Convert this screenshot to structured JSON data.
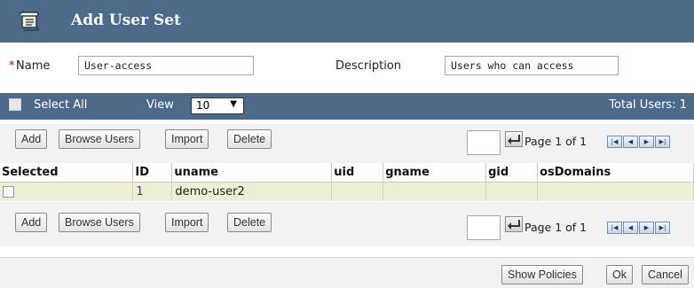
{
  "dialog": {
    "title": "Add User Set",
    "icon": "scroll-icon"
  },
  "form": {
    "required_marker": "*",
    "name_label": "Name",
    "name_value": "User-access",
    "description_label": "Description",
    "description_value": "Users who can access"
  },
  "toolbar": {
    "select_all_label": "Select All",
    "view_label": "View",
    "view_value": "10",
    "total_users": "Total Users: 1"
  },
  "actions": {
    "add": "Add",
    "browse_users": "Browse Users",
    "import": "Import",
    "delete": "Delete"
  },
  "pagination": {
    "page_text": "Page 1 of 1",
    "page_input": ""
  },
  "table": {
    "headers": [
      "Selected",
      "ID",
      "uname",
      "uid",
      "gname",
      "gid",
      "osDomains"
    ],
    "rows": [
      {
        "id": "1",
        "uname": "demo-user2",
        "uid": "",
        "gname": "",
        "gid": "",
        "osDomains": ""
      }
    ]
  },
  "footer": {
    "show_policies": "Show Policies",
    "ok": "Ok",
    "cancel": "Cancel"
  },
  "colors": {
    "header_bg": "#4d6b88",
    "row_bg": "#efefd7",
    "required": "#cc0000"
  }
}
